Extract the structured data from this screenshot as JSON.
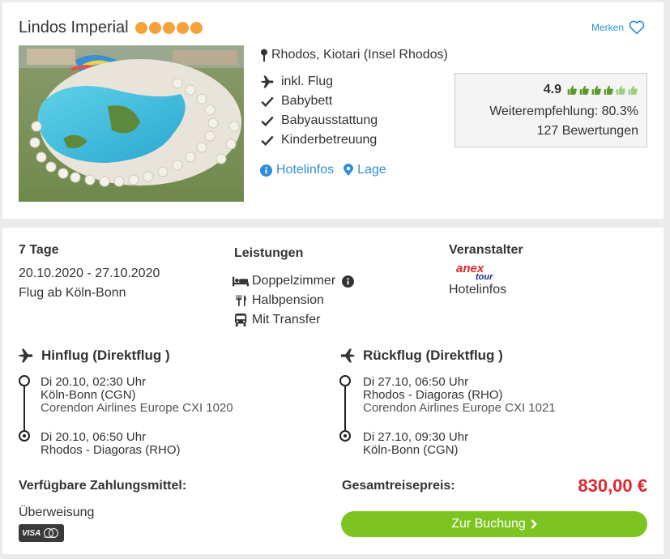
{
  "hotel": {
    "name": "Lindos Imperial",
    "stars": 5,
    "merken_label": "Merken",
    "location": "Rhodos, Kiotari (Insel Rhodos)",
    "features": [
      "inkl. Flug",
      "Babybett",
      "Babyausstattung",
      "Kinderbetreuung"
    ],
    "feature_icons": [
      "plane-icon",
      "check-icon",
      "check-icon",
      "check-icon"
    ],
    "links": {
      "hotelinfos": "Hotelinfos",
      "lage": "Lage"
    }
  },
  "rating": {
    "score": "4.9",
    "thumbs_value": 4.9,
    "thumbs_max": 6,
    "recommendation": "Weiterempfehlung: 80.3%",
    "reviews": "127 Bewertungen"
  },
  "trip": {
    "duration": "7 Tage",
    "dates": "20.10.2020 - 27.10.2020",
    "departure": "Flug ab Köln-Bonn"
  },
  "services": {
    "heading": "Leistungen",
    "items": [
      "Doppelzimmer",
      "Halbpension",
      "Mit Transfer"
    ],
    "icons": [
      "bed-icon",
      "cutlery-icon",
      "bus-icon"
    ]
  },
  "operator": {
    "heading": "Veranstalter",
    "logo_top": "anex",
    "logo_bottom": "tour",
    "link": "Hotelinfos"
  },
  "outbound": {
    "title": "Hinflug (Direktflug )",
    "dep_time": "Di 20.10, 02:30 Uhr",
    "dep_airport": "Köln-Bonn (CGN)",
    "airline": "Corendon Airlines Europe CXI 1020",
    "arr_time": "Di 20.10, 06:50 Uhr",
    "arr_airport": "Rhodos - Diagoras (RHO)"
  },
  "inbound": {
    "title": "Rückflug (Direktflug )",
    "dep_time": "Di 27.10, 06:50 Uhr",
    "dep_airport": "Rhodos - Diagoras (RHO)",
    "airline": "Corendon Airlines Europe CXI 1021",
    "arr_time": "Di 27.10, 09:30 Uhr",
    "arr_airport": "Köln-Bonn (CGN)"
  },
  "payment": {
    "heading": "Verfügbare Zahlungsmittel:",
    "method": "Überweisung",
    "visa": "VISA",
    "mastercard": "mastercard"
  },
  "total": {
    "label": "Gesamtreisepreis:",
    "price": "830,00 €",
    "button": "Zur Buchung"
  },
  "colors": {
    "accent_blue": "#2f8fd6",
    "star_orange": "#f7a13a",
    "thumb_green": "#5a9a2a",
    "price_red": "#e0262e",
    "button_green": "#7cc520"
  }
}
